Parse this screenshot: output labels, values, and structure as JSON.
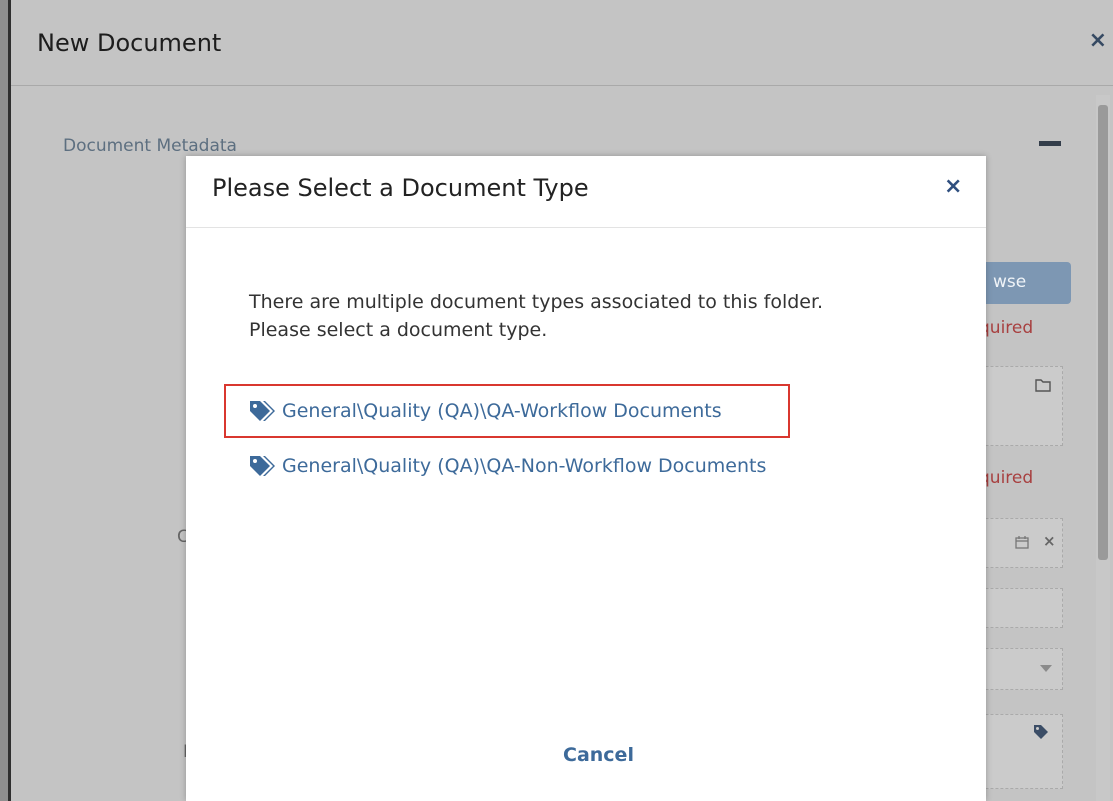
{
  "window": {
    "title": "New Document",
    "close_icon": "×"
  },
  "background": {
    "section_label": "Document Metadata",
    "browse_partial": "wse",
    "required_1": "quired",
    "required_2": "quired",
    "left_fragments": [
      "I",
      "C",
      "D"
    ]
  },
  "modal": {
    "title": "Please Select a Document Type",
    "close_icon": "×",
    "message_line1": "There are multiple document types associated to this folder.",
    "message_line2": "Please select a document type.",
    "options": [
      {
        "label": "General\\Quality (QA)\\QA-Workflow Documents",
        "icon": "tag-icon",
        "highlighted": true
      },
      {
        "label": "General\\Quality (QA)\\QA-Non-Workflow Documents",
        "icon": "tag-icon",
        "highlighted": false
      }
    ],
    "cancel_label": "Cancel"
  },
  "colors": {
    "accent": "#3d6a9a",
    "highlight": "#d9372f",
    "required": "#a84040"
  }
}
